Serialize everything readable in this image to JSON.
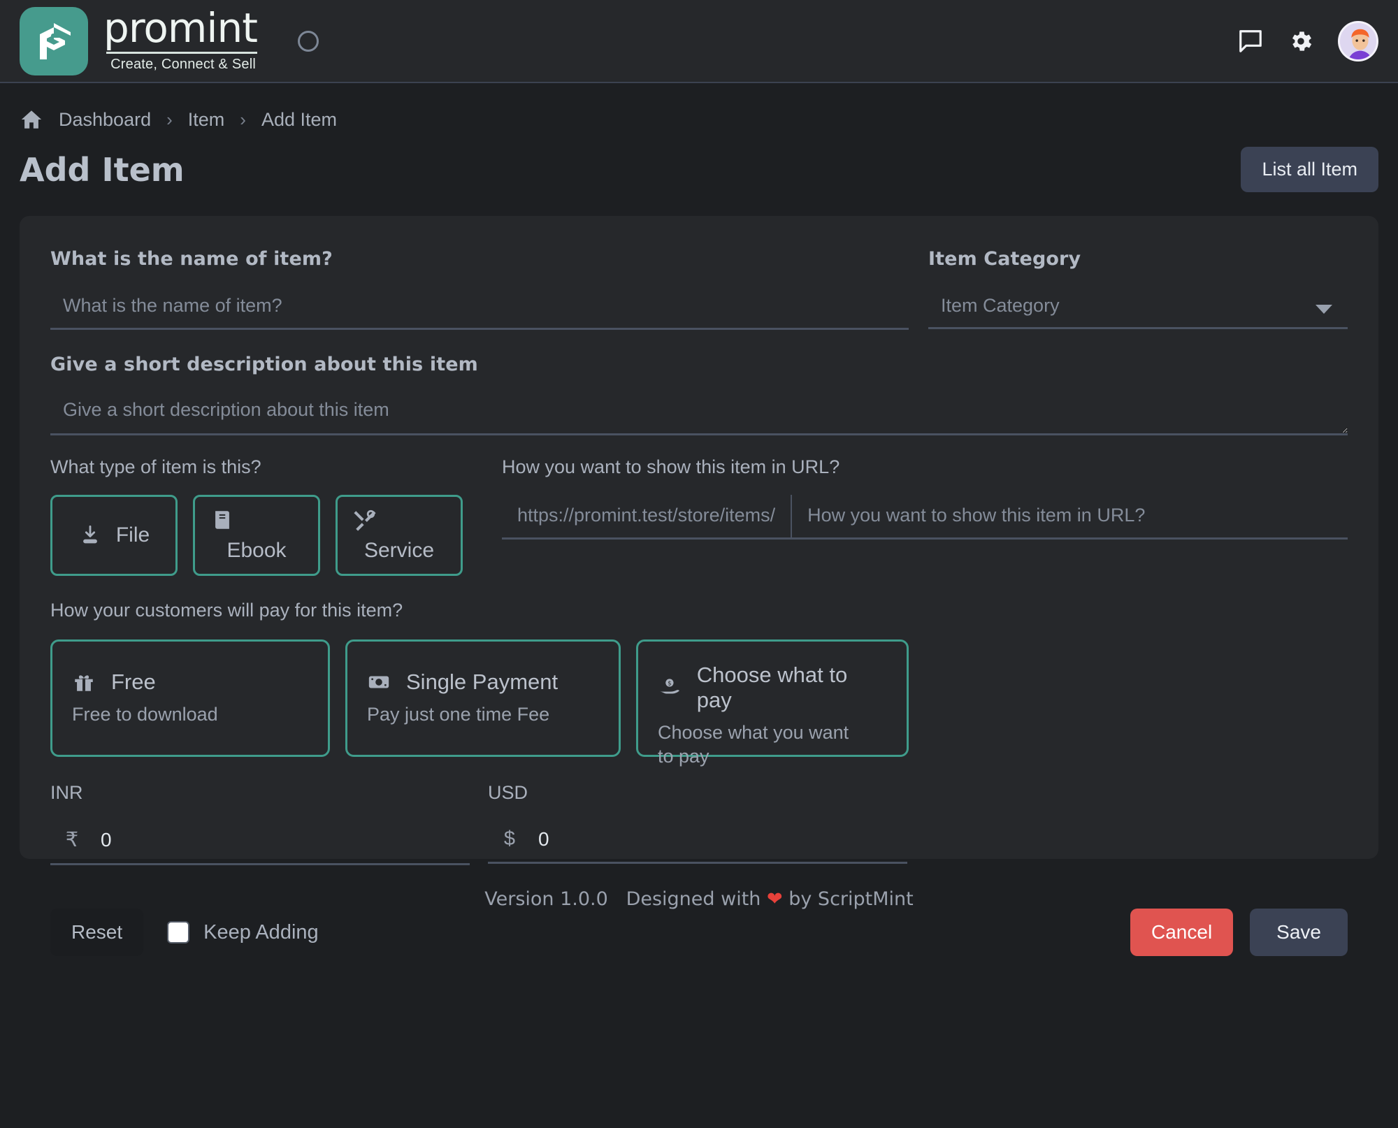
{
  "brand": {
    "name": "promint",
    "tagline": "Create, Connect & Sell",
    "logo_color": "#469b8d"
  },
  "topbar": {
    "menu_toggle": "circle-toggle",
    "icons": [
      "chat-icon",
      "gear-icon",
      "avatar"
    ]
  },
  "breadcrumb": {
    "home": "home-icon",
    "items": [
      "Dashboard",
      "Item",
      "Add Item"
    ],
    "separator": "›"
  },
  "header": {
    "title": "Add Item",
    "list_all_label": "List all Item"
  },
  "form": {
    "name": {
      "label": "What is the name of item?",
      "placeholder": "What is the name of item?",
      "value": ""
    },
    "category": {
      "label": "Item Category",
      "placeholder": "Item Category",
      "value": "",
      "options": [
        "Item Category"
      ]
    },
    "description": {
      "label": "Give a short description about this item",
      "placeholder": "Give a short description about this item",
      "value": ""
    },
    "item_type": {
      "label": "What type of item is this?",
      "options": [
        {
          "label": "File",
          "icon": "download-file-icon"
        },
        {
          "label": "Ebook",
          "icon": "book-icon"
        },
        {
          "label": "Service",
          "icon": "tools-icon"
        }
      ]
    },
    "url": {
      "label": "How you want to show this item in URL?",
      "prefix": "https://promint.test/store/items/",
      "placeholder": "How you want to show this item in URL?",
      "value": ""
    },
    "payment": {
      "label": "How your customers will pay for this item?",
      "options": [
        {
          "title": "Free",
          "subtitle": "Free to download",
          "icon": "gift-icon"
        },
        {
          "title": "Single Payment",
          "subtitle": "Pay just one time Fee",
          "icon": "money-icon"
        },
        {
          "title": "Choose what to pay",
          "subtitle": "Choose what you want to pay",
          "icon": "hand-coin-icon"
        }
      ]
    },
    "prices": [
      {
        "label": "INR",
        "symbol": "₹",
        "value": "0"
      },
      {
        "label": "USD",
        "symbol": "$",
        "value": "0"
      }
    ],
    "actions": {
      "reset": "Reset",
      "keep_adding": "Keep Adding",
      "keep_adding_checked": false,
      "cancel": "Cancel",
      "save": "Save"
    }
  },
  "footer": {
    "version": "Version 1.0.0",
    "designed_prefix": "Designed with",
    "heart": "❤",
    "designed_suffix": "by ScriptMint"
  },
  "colors": {
    "accent_teal": "#3f9c8b",
    "danger": "#e05450",
    "surface": "#26282b",
    "background": "#1d1f22"
  }
}
